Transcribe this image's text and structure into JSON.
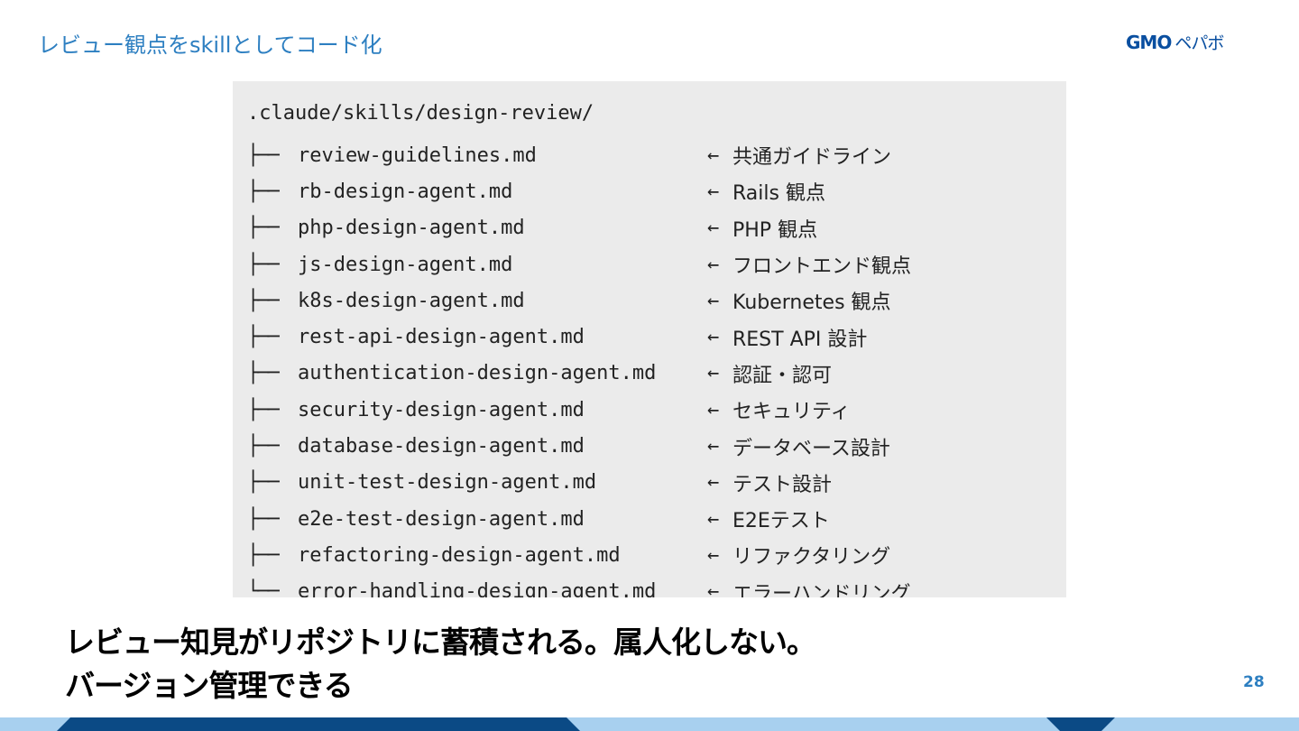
{
  "header": {
    "title": "レビュー観点をskillとしてコード化",
    "logo_mark": "GMO",
    "logo_sub": "ペパボ"
  },
  "code": {
    "root": ".claude/skills/design-review/",
    "arrow": "←",
    "branch_mid": "├──",
    "branch_last": "└──",
    "lines": [
      {
        "file": "review-guidelines.md",
        "desc": "共通ガイドライン"
      },
      {
        "file": "rb-design-agent.md",
        "desc": "Rails 観点"
      },
      {
        "file": "php-design-agent.md",
        "desc": "PHP 観点"
      },
      {
        "file": "js-design-agent.md",
        "desc": "フロントエンド観点"
      },
      {
        "file": "k8s-design-agent.md",
        "desc": "Kubernetes 観点"
      },
      {
        "file": "rest-api-design-agent.md",
        "desc": "REST API 設計"
      },
      {
        "file": "authentication-design-agent.md",
        "desc": "認証・認可"
      },
      {
        "file": "security-design-agent.md",
        "desc": "セキュリティ"
      },
      {
        "file": "database-design-agent.md",
        "desc": "データベース設計"
      },
      {
        "file": "unit-test-design-agent.md",
        "desc": "テスト設計"
      },
      {
        "file": "e2e-test-design-agent.md",
        "desc": "E2Eテスト"
      },
      {
        "file": "refactoring-design-agent.md",
        "desc": "リファクタリング"
      },
      {
        "file": "error-handling-design-agent.md",
        "desc": "エラーハンドリング"
      }
    ]
  },
  "footer": {
    "line1": "レビュー知見がリポジトリに蓄積される。属人化しない。",
    "line2": "バージョン管理できる",
    "page_number": "28"
  },
  "colors": {
    "accent": "#2d7fc1",
    "band_dark": "#0b4a85",
    "band_light": "#a8d0ef",
    "code_bg": "#ebebeb"
  }
}
